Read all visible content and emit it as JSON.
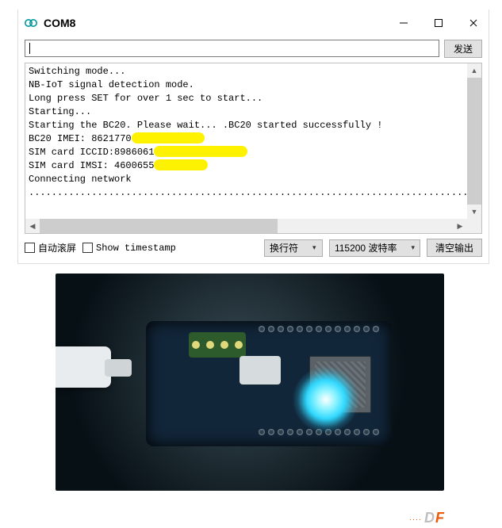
{
  "window": {
    "title": "COM8"
  },
  "toolbar": {
    "send_label": "发送"
  },
  "input": {
    "value": ""
  },
  "console": {
    "lines": [
      "Switching mode...",
      "NB-IoT signal detection mode.",
      "Long press SET for over 1 sec to start...",
      "Starting...",
      "Starting the BC20. Please wait... .BC20 started successfully !"
    ],
    "imei_prefix": "BC20 IMEI: 8621770",
    "iccid_prefix": "SIM card ICCID:8986061",
    "imsi_prefix": "SIM card IMSI: 4600655",
    "connecting": "Connecting network",
    "dots": "............................................................................................"
  },
  "status": {
    "autoscroll_label": "自动滚屏",
    "timestamp_label": "Show timestamp",
    "line_ending": "换行符",
    "baud": "115200 波特率",
    "clear_label": "清空输出"
  },
  "photo": {
    "watermark_d": "D",
    "watermark_f": "F"
  }
}
